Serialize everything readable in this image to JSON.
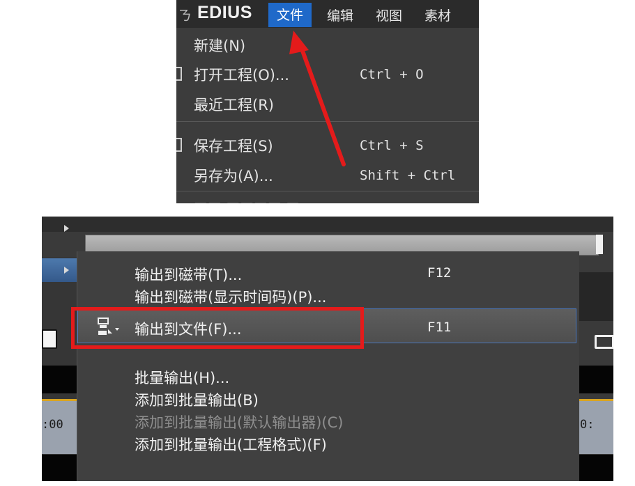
{
  "menubar": {
    "app_name": "EDIUS",
    "menus": [
      "文件",
      "编辑",
      "视图",
      "素材"
    ],
    "active_menu": "文件"
  },
  "file_menu": {
    "items": [
      {
        "label": "新建(N)",
        "shortcut": ""
      },
      {
        "label": "打开工程(O)...",
        "shortcut": "Ctrl + O"
      },
      {
        "label": "最近工程(R)",
        "shortcut": ""
      },
      {
        "label": "保存工程(S)",
        "shortcut": "Ctrl + S"
      },
      {
        "label": "另存为(A)...",
        "shortcut": "Shift + Ctrl"
      }
    ]
  },
  "export_menu": {
    "items": [
      {
        "label": "输出到磁带(T)...",
        "shortcut": "F12",
        "enabled": true
      },
      {
        "label": "输出到磁带(显示时间码)(P)...",
        "shortcut": "",
        "enabled": true
      },
      {
        "label": "输出到文件(F)...",
        "shortcut": "F11",
        "enabled": true,
        "highlighted": true
      },
      {
        "label": "批量输出(H)...",
        "shortcut": "",
        "enabled": true
      },
      {
        "label": "添加到批量输出(B)",
        "shortcut": "",
        "enabled": true
      },
      {
        "label": "添加到批量输出(默认输出器)(C)",
        "shortcut": "",
        "enabled": false
      },
      {
        "label": "添加到批量输出(工程格式)(F)",
        "shortcut": "",
        "enabled": true
      }
    ]
  },
  "timeline": {
    "left_time": ":00",
    "right_time": "0:"
  },
  "colors": {
    "menu_active": "#1f69c9",
    "annotation_red": "#e41b1b",
    "highlight_border": "#4a78c0",
    "timeline_accent": "#d9a420"
  },
  "icons": [
    "app-icon",
    "red-annotation-arrow",
    "export-file-icon",
    "document-icon",
    "loop-icon"
  ]
}
